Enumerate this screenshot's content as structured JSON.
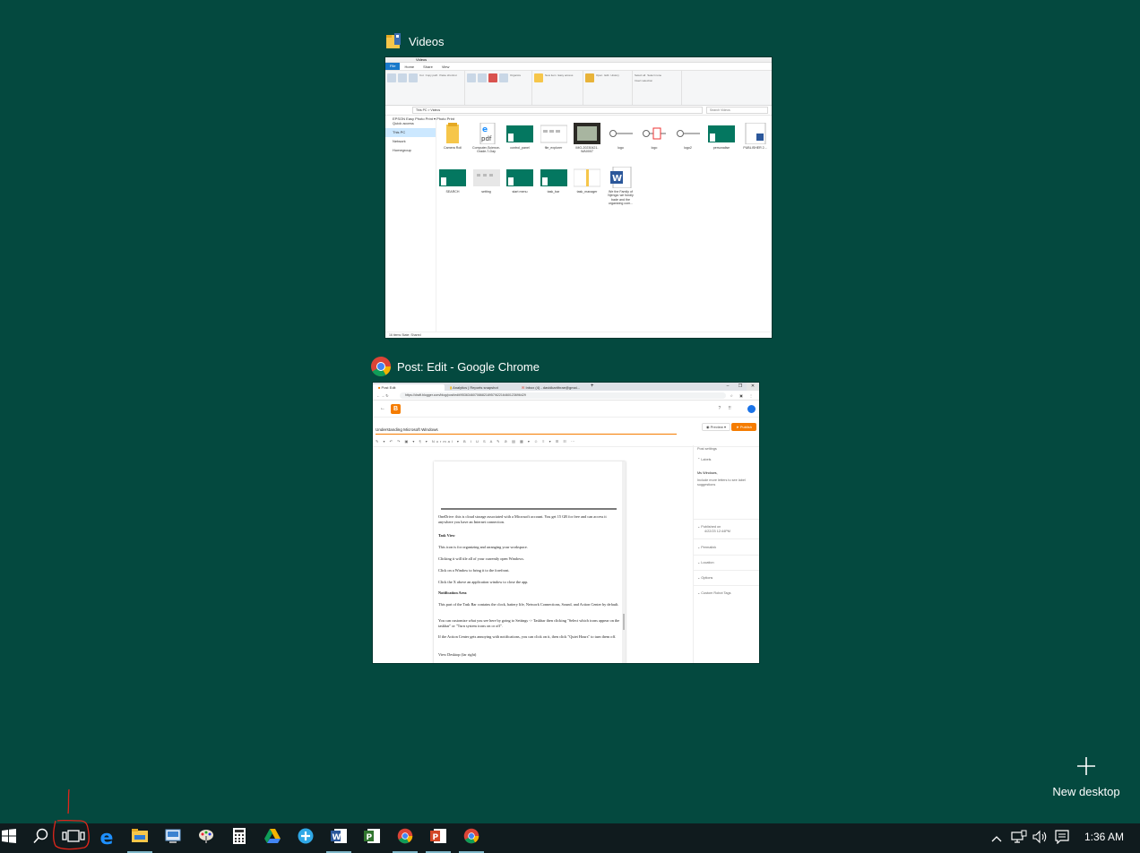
{
  "screen": {
    "background": "#04493f"
  },
  "windows": {
    "explorer": {
      "title": "Videos",
      "titlebar_text": "Videos",
      "tabs": [
        "File",
        "Home",
        "Share",
        "View"
      ],
      "ribbon": {
        "clipboard": [
          "Pin to Quick access",
          "Copy",
          "Paste",
          "Cut",
          "Copy path",
          "Paste shortcut",
          "Clipboard"
        ],
        "organize": [
          "Move to",
          "Copy to",
          "Delete",
          "Rename",
          "Organize"
        ],
        "new": [
          "New folder",
          "New item",
          "Easy access",
          "New"
        ],
        "open": [
          "Properties",
          "Open",
          "Edit",
          "History",
          "Open"
        ],
        "select": [
          "Select all",
          "Select none",
          "Invert selection",
          "Select"
        ]
      },
      "breadcrumb": "This PC  >  Videos",
      "search_placeholder": "Search Videos",
      "toolbar2": "EPSON  Easy Photo Print  ▾  Photo Print",
      "nav": [
        "Quick access",
        "This PC",
        "Network",
        "Homegroup"
      ],
      "files": [
        {
          "name": "Camera Roll",
          "kind": "folder"
        },
        {
          "name": "Computer-Science-Grade-7-Day",
          "kind": "pdf"
        },
        {
          "name": "control_panel",
          "kind": "teal"
        },
        {
          "name": "file_explorer",
          "kind": "doc"
        },
        {
          "name": "IMG-20230421-WA0007",
          "kind": "photo"
        },
        {
          "name": "logo",
          "kind": "logo"
        },
        {
          "name": "logo",
          "kind": "logo2"
        },
        {
          "name": "logo2",
          "kind": "logo"
        },
        {
          "name": "personalise",
          "kind": "teal"
        },
        {
          "name": "PUBLISHER 2...",
          "kind": "docblue"
        },
        {
          "name": "SEARCH",
          "kind": "teal"
        },
        {
          "name": "setting",
          "kind": "grey"
        },
        {
          "name": "start menu",
          "kind": "teal"
        },
        {
          "name": "task_bar",
          "kind": "teal"
        },
        {
          "name": "task_manager",
          "kind": "yellow"
        },
        {
          "name": "We the Family of Njenga: we fondly bade and the organizing com...",
          "kind": "word"
        }
      ],
      "status": "16 items    State: Shared"
    },
    "chrome": {
      "title": "Post: Edit - Google Chrome",
      "tabs": [
        "Post Edit",
        "Analytics | Reports snapshot",
        "Inbox (4) - davidkarithrae@gmai..."
      ],
      "url": "https://draft.blogger.com/blog/post/edit/9536346070868218957/62216460123696429",
      "post_title": "Understanding Microsoft Windows",
      "preview_label": "Preview",
      "publish_label": "Publish",
      "toolbar": "✎ ▾  ↶ ↷  ▣ ▾  ¶ ▾  Normal ▾   B  I  U  S  A  ✎  ⊘  ▤  ▦ ▾  ☺   ≡ ▾  ☰  ☷  ⋯",
      "doc": [
        {
          "text": "OneDrive: this is cloud storage associated with a Microsoft account. You get 15 GB for free and can access it anywhere you have an Internet connection.",
          "bold": false
        },
        {
          "text": "Task View",
          "bold": true
        },
        {
          "text": "This icon is for organizing and arranging your workspace.",
          "bold": false
        },
        {
          "text": "Clicking it will tile all of your currently open Windows.",
          "bold": false
        },
        {
          "text": "Click on a Window to bring it to the forefront.",
          "bold": false
        },
        {
          "text": "Click the X above an application window to close the app.",
          "bold": false
        },
        {
          "text": "Notification Area",
          "bold": true
        },
        {
          "text": "This part of the Task Bar contains the clock, battery life, Network Connections, Sound, and Action Center by default.",
          "bold": false
        },
        {
          "text": "You can customize what you see here by going to Settings -> Taskbar then clicking \"Select which icons appear on the taskbar\" or \"Turn system icons on or off\".",
          "bold": false
        },
        {
          "text": "If the Action Center gets annoying with notifications, you can click on it, then click \"Quiet Hours\" to turn them off.",
          "bold": false
        },
        {
          "text": "View Desktop (far right)",
          "bold": false
        }
      ],
      "sidebar": {
        "heading": "Post settings",
        "labels_title": "Labels",
        "labels_value": "Ms Windows,",
        "labels_hint": "Include more letters to see label suggestions",
        "published": "Published on",
        "published_date": "4/22/23 12:44PM",
        "items": [
          "Permalink",
          "Location",
          "Options",
          "Custom Robot Tags"
        ]
      }
    }
  },
  "desktop": {
    "new_desktop_label": "New desktop"
  },
  "taskbar": {
    "apps": [
      "start-icon",
      "search-icon",
      "task-view-icon",
      "edge-icon",
      "file-explorer-icon",
      "control-panel-icon",
      "paint-icon",
      "calculator-icon",
      "drive-icon",
      "app-plus-icon",
      "word-icon",
      "project-icon",
      "chrome-icon",
      "powerpoint-icon",
      "chrome-icon"
    ],
    "clock": "1:36 AM"
  },
  "colors": {
    "accent": "#f57c00",
    "teal": "#047760",
    "taskbar": "#101b1e",
    "annotation": "#e0261b"
  }
}
